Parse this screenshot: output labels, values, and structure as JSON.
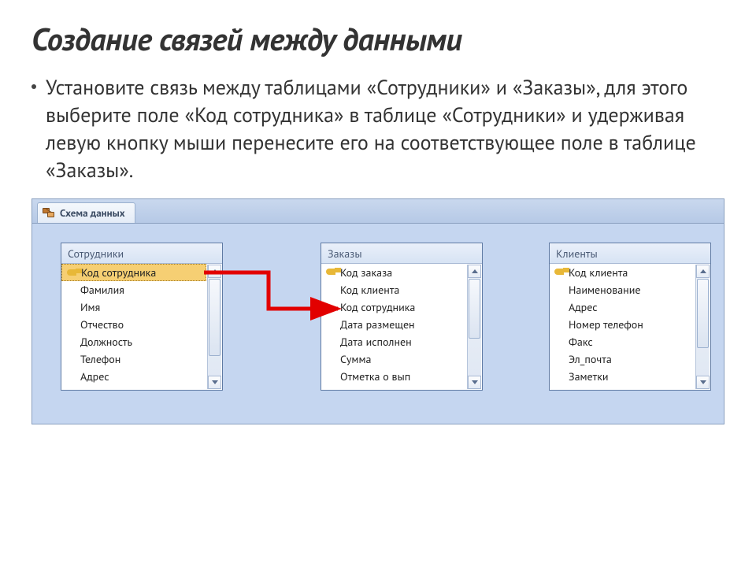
{
  "title": "Создание связей между данными",
  "body": "Установите связь между таблицами «Сотрудники» и «Заказы», для этого выберите поле «Код сотрудника» в таблице «Сотрудники» и удерживая левую кнопку мыши перенесите его на соответствующее поле в таблице «Заказы».",
  "tab_label": "Схема данных",
  "tables": {
    "t1": {
      "title": "Сотрудники",
      "fields": [
        "Код сотрудника",
        "Фамилия",
        "Имя",
        "Отчество",
        "Должность",
        "Телефон",
        "Адрес"
      ]
    },
    "t2": {
      "title": "Заказы",
      "fields": [
        "Код заказа",
        "Код клиента",
        "Код сотрудника",
        "Дата размещен",
        "Дата исполнен",
        "Сумма",
        "Отметка о вып"
      ]
    },
    "t3": {
      "title": "Клиенты",
      "fields": [
        "Код клиента",
        "Наименование",
        "Адрес",
        "Номер телефон",
        "Факс",
        "Эл_почта",
        "Заметки"
      ]
    }
  }
}
